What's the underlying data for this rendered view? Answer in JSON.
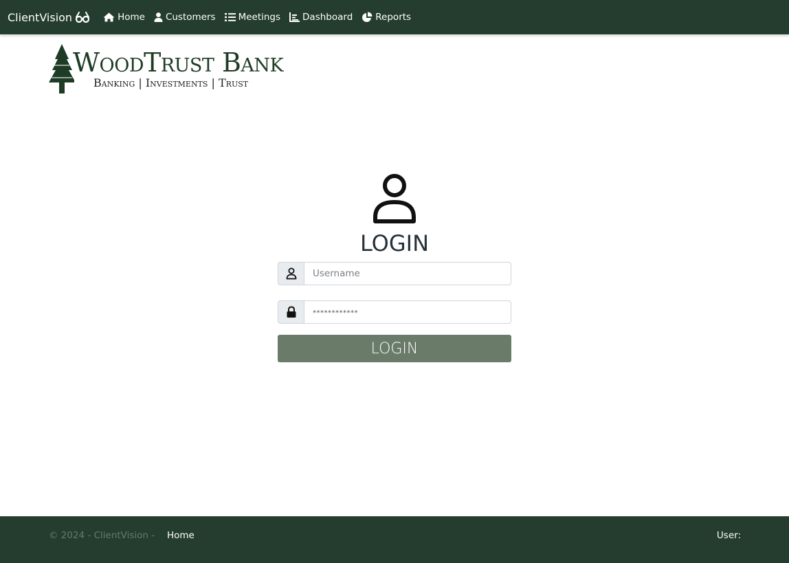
{
  "navbar": {
    "brand": "ClientVision",
    "brand_icon": "glasses-icon",
    "items": [
      {
        "label": "Home",
        "icon": "home-icon"
      },
      {
        "label": "Customers",
        "icon": "user-icon"
      },
      {
        "label": "Meetings",
        "icon": "list-icon"
      },
      {
        "label": "Dashboard",
        "icon": "chart-icon"
      },
      {
        "label": "Reports",
        "icon": "pie-chart-icon"
      }
    ]
  },
  "logo": {
    "title": "WoodTrust Bank",
    "subtitle": "Banking | Investments | Trust"
  },
  "login": {
    "title": "LOGIN",
    "username_placeholder": "Username",
    "password_placeholder": "************",
    "button_label": "LOGIN"
  },
  "footer": {
    "copyright": "© 2024 - ClientVision -",
    "home_link": "Home",
    "user_label": "User:"
  },
  "colors": {
    "navbar_bg": "#243d2e",
    "logo_green": "#1d3b25",
    "button_bg": "#6a7b6a"
  }
}
